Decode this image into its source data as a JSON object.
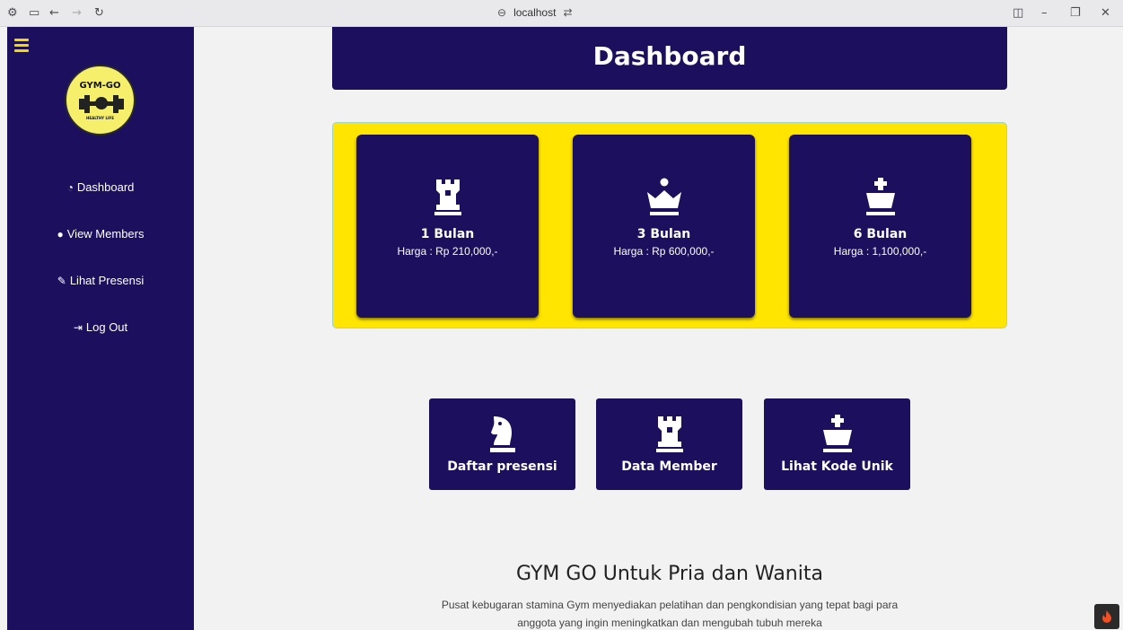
{
  "browser": {
    "address": "localhost"
  },
  "sidebar": {
    "logo_text": "GYM-GO",
    "logo_subtext": "HEALTHY LIFE",
    "items": [
      {
        "label": "Dashboard",
        "icon": "gauge-icon"
      },
      {
        "label": "View Members",
        "icon": "user-icon"
      },
      {
        "label": "Lihat Presensi",
        "icon": "pencil-icon"
      },
      {
        "label": "Log Out",
        "icon": "sign-out-icon"
      }
    ]
  },
  "header": {
    "title": "Dashboard"
  },
  "plans": [
    {
      "title": "1 Bulan",
      "price": "Harga : Rp 210,000,-",
      "icon": "chess-rook-icon"
    },
    {
      "title": "3 Bulan",
      "price": "Harga : Rp 600,000,-",
      "icon": "chess-queen-icon"
    },
    {
      "title": "6 Bulan",
      "price": "Harga : 1,100,000,-",
      "icon": "chess-king-icon"
    }
  ],
  "actions": [
    {
      "label": "Daftar presensi",
      "icon": "chess-knight-icon"
    },
    {
      "label": "Data Member",
      "icon": "chess-rook-icon"
    },
    {
      "label": "Lihat Kode Unik",
      "icon": "chess-king-icon"
    }
  ],
  "about": {
    "title": "GYM GO Untuk Pria dan Wanita",
    "text": "Pusat kebugaran stamina Gym menyediakan pelatihan dan pengkondisian yang tepat bagi para anggota yang ingin meningkatkan dan mengubah tubuh mereka"
  },
  "colors": {
    "primary": "#1b0f5e",
    "accent": "#ffe500",
    "background": "#f2f2f2"
  }
}
